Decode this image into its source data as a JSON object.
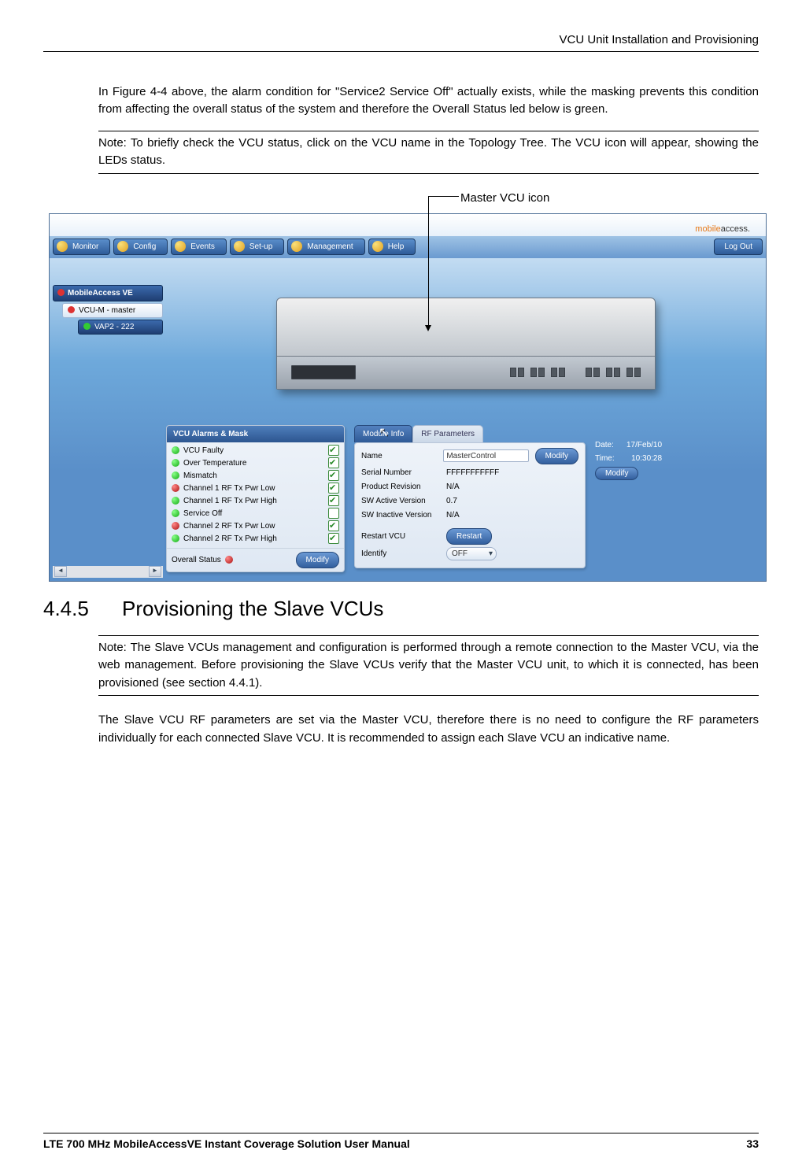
{
  "header": "VCU Unit Installation and Provisioning",
  "para1": "In Figure 4-4 above, the alarm condition for \"Service2 Service Off\" actually exists, while the masking prevents this condition from affecting the overall status of the system and therefore the Overall Status led below is green.",
  "note1": "Note: To briefly check the VCU status, click on the VCU name in the Topology Tree. The VCU icon will appear, showing the LEDs status.",
  "callout": "Master VCU icon",
  "app": {
    "logo": "mobileaccess.",
    "menu": [
      "Monitor",
      "Config",
      "Events",
      "Set-up",
      "Management",
      "Help"
    ],
    "logout": "Log Out",
    "tree": {
      "root": "MobileAccess VE",
      "node1": "VCU-M - master",
      "node2": "VAP2 - 222"
    },
    "alarms": {
      "title": "VCU Alarms & Mask",
      "items": [
        {
          "c": "g",
          "label": "VCU Faulty",
          "on": true
        },
        {
          "c": "g",
          "label": "Over Temperature",
          "on": true
        },
        {
          "c": "g",
          "label": "Mismatch",
          "on": true
        },
        {
          "c": "r",
          "label": "Channel 1 RF Tx Pwr Low",
          "on": true
        },
        {
          "c": "g",
          "label": "Channel 1 RF Tx Pwr High",
          "on": true
        },
        {
          "c": "g",
          "label": "Service Off",
          "on": false
        },
        {
          "c": "r",
          "label": "Channel 2 RF Tx Pwr Low",
          "on": true
        },
        {
          "c": "g",
          "label": "Channel 2 RF Tx Pwr High",
          "on": true
        }
      ],
      "overall": "Overall Status",
      "modify": "Modify"
    },
    "module": {
      "tab1": "Module Info",
      "tab2": "RF Parameters",
      "name_l": "Name",
      "name_v": "MasterControl",
      "modify": "Modify",
      "sn_l": "Serial Number",
      "sn_v": "FFFFFFFFFFF",
      "pr_l": "Product Revision",
      "pr_v": "N/A",
      "sa_l": "SW Active Version",
      "sa_v": "0.7",
      "si_l": "SW Inactive Version",
      "si_v": "N/A",
      "restart_l": "Restart VCU",
      "restart_b": "Restart",
      "ident_l": "Identify",
      "ident_v": "OFF"
    },
    "datetime": {
      "date_l": "Date:",
      "date_v": "17/Feb/10",
      "time_l": "Time:",
      "time_v": "10:30:28",
      "modify": "Modify"
    }
  },
  "section": {
    "num": "4.4.5",
    "title": "Provisioning the Slave VCUs"
  },
  "note2": "Note: The Slave VCUs management and configuration is performed through a remote connection to the Master VCU, via the web management. Before provisioning the Slave VCUs verify that the Master VCU unit, to which it is connected, has been provisioned (see section 4.4.1).",
  "para2": "The Slave VCU RF parameters are set via the Master VCU, therefore there is no need to configure the RF parameters individually for each connected Slave VCU. It is recommended to assign each Slave VCU an indicative name.",
  "footer": {
    "title": "LTE 700 MHz MobileAccessVE Instant Coverage Solution User Manual",
    "page": "33"
  }
}
